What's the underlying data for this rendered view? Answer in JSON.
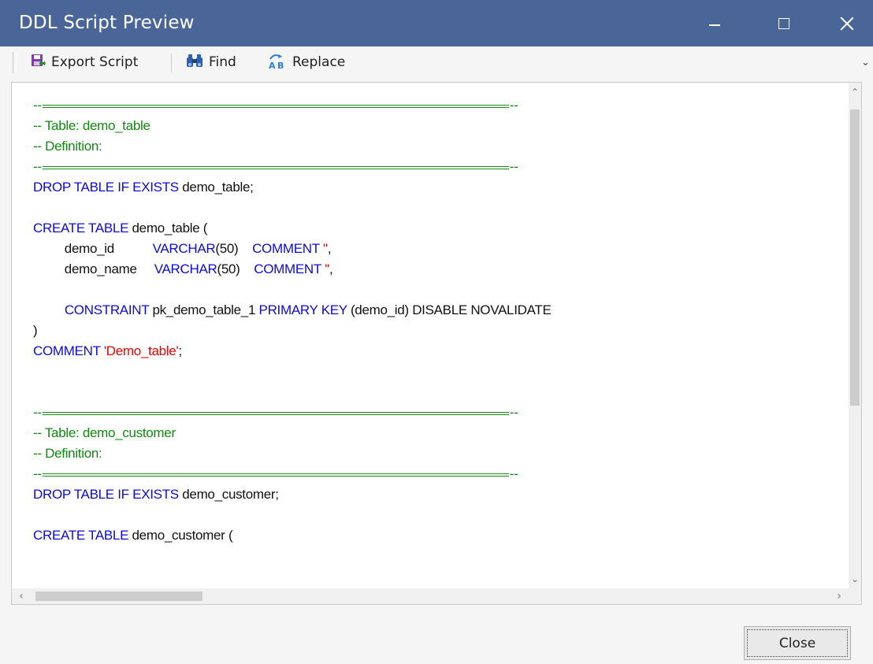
{
  "window": {
    "title": "DDL Script Preview",
    "colors": {
      "titlebar": "#4a6699",
      "comment": "#118811",
      "keyword": "#0b0bdd",
      "string": "#ee0000"
    }
  },
  "toolbar": {
    "export_label": "Export Script",
    "find_label": "Find",
    "replace_label": "Replace"
  },
  "script": {
    "lines": [
      [
        {
          "cls": "c",
          "text": "--"
        },
        {
          "rule": true
        },
        {
          "cls": "c",
          "text": "--"
        }
      ],
      [
        {
          "cls": "c",
          "text": "-- Table: demo_table"
        }
      ],
      [
        {
          "cls": "c",
          "text": "-- Definition:"
        }
      ],
      [
        {
          "cls": "c",
          "text": "--"
        },
        {
          "rule": true
        },
        {
          "cls": "c",
          "text": "--"
        }
      ],
      [
        {
          "cls": "k",
          "text": "DROP TABLE IF EXISTS "
        },
        {
          "cls": "t",
          "text": "demo_table;"
        }
      ],
      [],
      [
        {
          "cls": "k",
          "text": "CREATE TABLE "
        },
        {
          "cls": "t",
          "text": "demo_table ("
        }
      ],
      [
        {
          "cls": "t",
          "text": "         demo_id           "
        },
        {
          "cls": "k",
          "text": "VARCHAR"
        },
        {
          "cls": "t",
          "text": "(50)    "
        },
        {
          "cls": "k",
          "text": "COMMENT "
        },
        {
          "cls": "s",
          "text": "''"
        },
        {
          "cls": "t",
          "text": ","
        }
      ],
      [
        {
          "cls": "t",
          "text": "         demo_name     "
        },
        {
          "cls": "k",
          "text": "VARCHAR"
        },
        {
          "cls": "t",
          "text": "(50)    "
        },
        {
          "cls": "k",
          "text": "COMMENT "
        },
        {
          "cls": "s",
          "text": "''"
        },
        {
          "cls": "t",
          "text": ","
        }
      ],
      [],
      [
        {
          "cls": "t",
          "text": "         "
        },
        {
          "cls": "k",
          "text": "CONSTRAINT "
        },
        {
          "cls": "t",
          "text": "pk_demo_table_1 "
        },
        {
          "cls": "k",
          "text": "PRIMARY KEY "
        },
        {
          "cls": "t",
          "text": "(demo_id) DISABLE NOVALIDATE"
        }
      ],
      [
        {
          "cls": "t",
          "text": ")"
        }
      ],
      [
        {
          "cls": "k",
          "text": "COMMENT "
        },
        {
          "cls": "s",
          "text": "'Demo_table'"
        },
        {
          "cls": "t",
          "text": ";"
        }
      ],
      [],
      [],
      [
        {
          "cls": "c",
          "text": "--"
        },
        {
          "rule": true
        },
        {
          "cls": "c",
          "text": "--"
        }
      ],
      [
        {
          "cls": "c",
          "text": "-- Table: demo_customer"
        }
      ],
      [
        {
          "cls": "c",
          "text": "-- Definition:"
        }
      ],
      [
        {
          "cls": "c",
          "text": "--"
        },
        {
          "rule": true
        },
        {
          "cls": "c",
          "text": "--"
        }
      ],
      [
        {
          "cls": "k",
          "text": "DROP TABLE IF EXISTS "
        },
        {
          "cls": "t",
          "text": "demo_customer;"
        }
      ],
      [],
      [
        {
          "cls": "k",
          "text": "CREATE TABLE "
        },
        {
          "cls": "t",
          "text": "demo_customer ("
        }
      ]
    ]
  },
  "footer": {
    "close_label": "Close"
  },
  "icons": {
    "export": "export-script-icon",
    "find": "binoculars-icon",
    "replace": "replace-ab-icon"
  }
}
